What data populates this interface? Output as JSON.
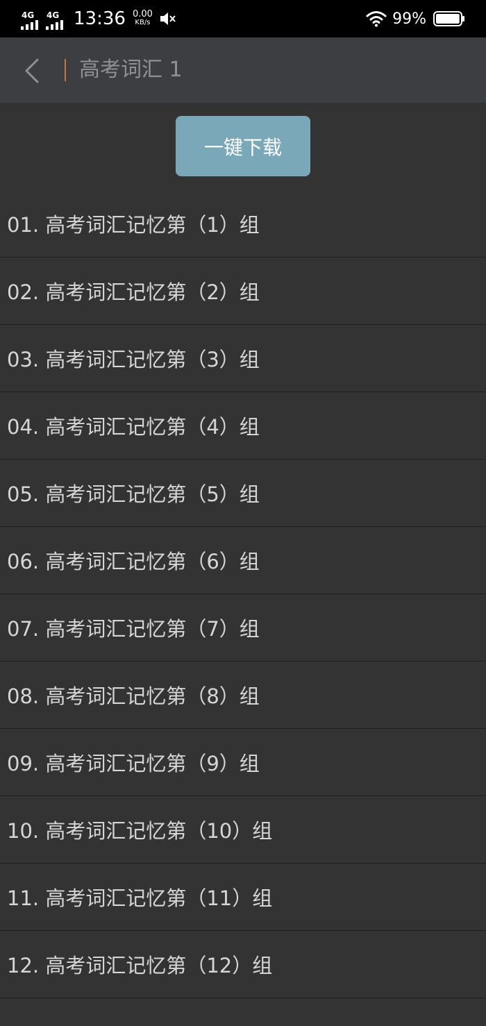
{
  "status_bar": {
    "signal_1_label": "4G",
    "signal_2_label": "4G",
    "time": "13:36",
    "net_speed_value": "0.00",
    "net_speed_unit": "KB/s",
    "battery_percent": "99%",
    "battery_level": 0.99
  },
  "app_bar": {
    "title": "高考词汇 1"
  },
  "download_button": {
    "label": "一键下载"
  },
  "list": {
    "items": [
      {
        "label": "01. 高考词汇记忆第（1）组"
      },
      {
        "label": "02. 高考词汇记忆第（2）组"
      },
      {
        "label": "03. 高考词汇记忆第（3）组"
      },
      {
        "label": "04. 高考词汇记忆第（4）组"
      },
      {
        "label": "05. 高考词汇记忆第（5）组"
      },
      {
        "label": "06. 高考词汇记忆第（6）组"
      },
      {
        "label": "07. 高考词汇记忆第（7）组"
      },
      {
        "label": "08. 高考词汇记忆第（8）组"
      },
      {
        "label": "09. 高考词汇记忆第（9）组"
      },
      {
        "label": "10. 高考词汇记忆第（10）组"
      },
      {
        "label": "11. 高考词汇记忆第（11）组"
      },
      {
        "label": "12. 高考词汇记忆第（12）组"
      }
    ]
  },
  "colors": {
    "background": "#333333",
    "app_bar": "#3d3e42",
    "accent_divider": "#c9773b",
    "button": "#7ba8b8"
  },
  "icons": [
    "signal-icon",
    "mute-icon",
    "wifi-icon",
    "battery-icon",
    "back-arrow-icon"
  ]
}
